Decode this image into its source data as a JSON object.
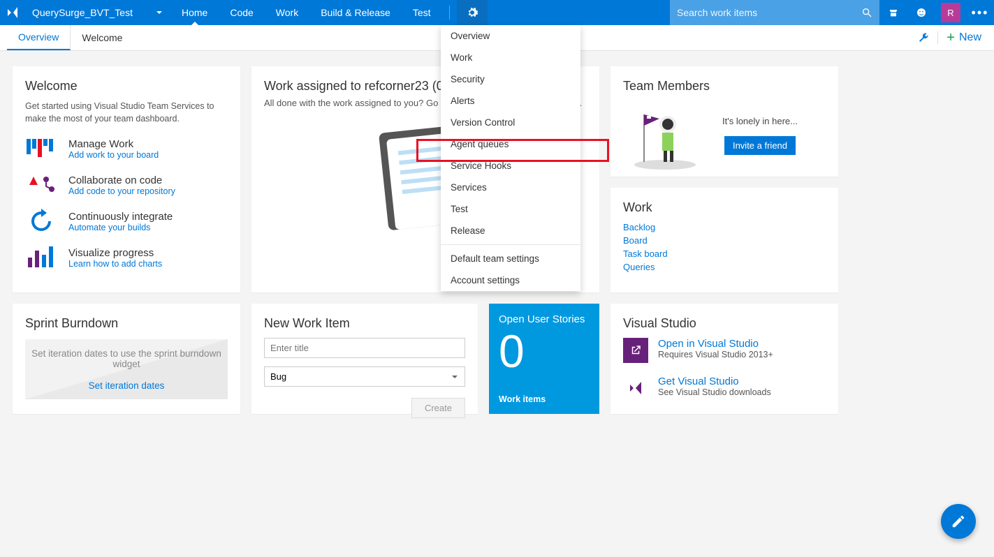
{
  "topbar": {
    "project": "QuerySurge_BVT_Test",
    "nav": [
      "Home",
      "Code",
      "Work",
      "Build & Release",
      "Test"
    ],
    "active_nav": 0,
    "search_placeholder": "Search work items",
    "avatar_initial": "R"
  },
  "subnav": {
    "tabs": [
      "Overview",
      "Welcome"
    ],
    "active": 0,
    "new_label": "New"
  },
  "settings_menu": {
    "group1": [
      "Overview",
      "Work",
      "Security",
      "Alerts",
      "Version Control",
      "Agent queues",
      "Service Hooks",
      "Services",
      "Test",
      "Release"
    ],
    "group2": [
      "Default team settings",
      "Account settings"
    ],
    "highlight_index": 5
  },
  "welcome": {
    "title": "Welcome",
    "desc": "Get started using Visual Studio Team Services to make the most of your team dashboard.",
    "items": [
      {
        "title": "Manage Work",
        "link": "Add work to your board"
      },
      {
        "title": "Collaborate on code",
        "link": "Add code to your repository"
      },
      {
        "title": "Continuously integrate",
        "link": "Automate your builds"
      },
      {
        "title": "Visualize progress",
        "link": "Learn how to add charts"
      }
    ]
  },
  "work_assigned": {
    "title": "Work assigned to refcorner23 (0)",
    "desc": "All done with the work assigned to you? Go to the backlog to pick up new work."
  },
  "team_members": {
    "title": "Team Members",
    "lonely": "It's lonely in here...",
    "button": "Invite a friend"
  },
  "work_links": {
    "title": "Work",
    "links": [
      "Backlog",
      "Board",
      "Task board",
      "Queries"
    ]
  },
  "sprint": {
    "title": "Sprint Burndown",
    "msg": "Set iteration dates to use the sprint burndown widget",
    "link": "Set iteration dates"
  },
  "new_item": {
    "title": "New Work Item",
    "placeholder": "Enter title",
    "type": "Bug",
    "create": "Create"
  },
  "user_stories": {
    "title": "Open User Stories",
    "count": "0",
    "sub": "Work items"
  },
  "visual_studio": {
    "title": "Visual Studio",
    "items": [
      {
        "link": "Open in Visual Studio",
        "sub": "Requires Visual Studio 2013+"
      },
      {
        "link": "Get Visual Studio",
        "sub": "See Visual Studio downloads"
      }
    ]
  }
}
